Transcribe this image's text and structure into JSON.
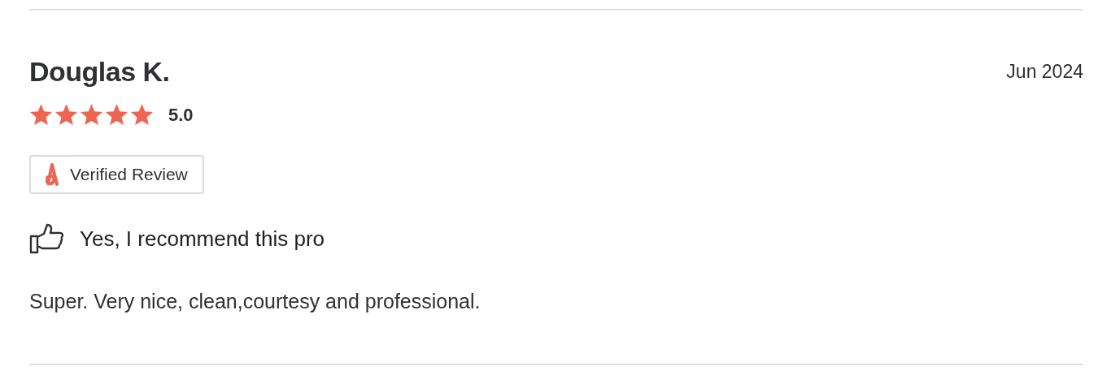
{
  "review": {
    "author": "Douglas K.",
    "date": "Jun 2024",
    "stars": 5,
    "rating": "5.0",
    "badge": "Verified Review",
    "recommendation": "Yes, I recommend this pro",
    "text": "Super. Very nice, clean,courtesy and professional."
  }
}
